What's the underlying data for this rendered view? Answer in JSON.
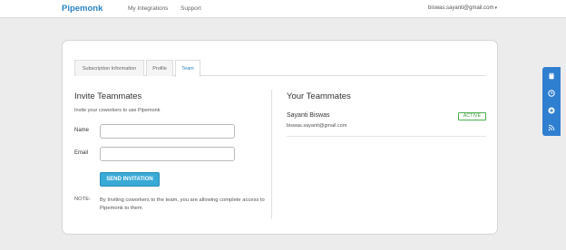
{
  "topbar": {
    "brand": "Pipemonk",
    "nav": [
      "My Integrations",
      "Support"
    ],
    "user_email": "biswas.sayanti@gmail.com",
    "caret": "▾"
  },
  "tabs": [
    "Subscription Information",
    "Profile",
    "Team"
  ],
  "active_tab": "Team",
  "invite": {
    "title": "Invite Teammates",
    "subtitle": "Invite your coworkers to use Pipemonk",
    "name_label": "Name",
    "name_value": "",
    "email_label": "Email",
    "email_value": "",
    "button": "SEND INVITATION",
    "note_label": "NOTE-",
    "note_text": "By Inviting coworkers to the team, you are allowing complete access to Pipemonk to them"
  },
  "teammates": {
    "title": "Your Teammates",
    "members": [
      {
        "name": "Sayanti Biswas",
        "email": "biswas.sayanti@gmail.com",
        "status": "ACTIVE"
      }
    ]
  },
  "side_toolbar": {
    "icons": [
      "book-icon",
      "clock-icon",
      "plus-circle-icon",
      "rss-icon"
    ]
  },
  "colors": {
    "brand": "#2a83c6",
    "button": "#39a9d6",
    "active_badge": "#4cae4c",
    "side_toolbar": "#2f7fd0"
  }
}
